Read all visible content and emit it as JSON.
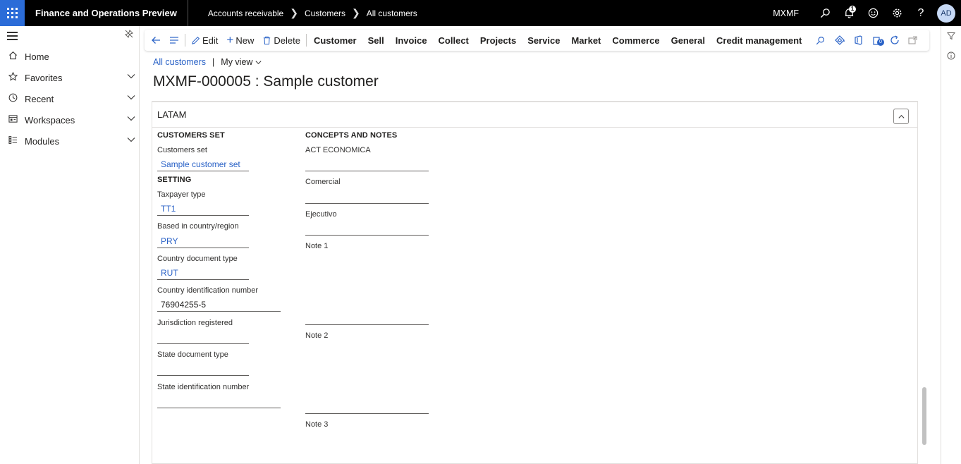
{
  "topbar": {
    "app_title": "Finance and Operations Preview",
    "breadcrumbs": [
      "Accounts receivable",
      "Customers",
      "All customers"
    ],
    "company": "MXMF",
    "notification_count": "1",
    "user_initials": "AD",
    "icons": [
      "waffle-icon",
      "search-icon",
      "bell-icon",
      "smiley-icon",
      "gear-icon",
      "help-icon"
    ]
  },
  "nav": {
    "items": [
      {
        "label": "Home",
        "icon": "home-icon",
        "expandable": false
      },
      {
        "label": "Favorites",
        "icon": "star-icon",
        "expandable": true
      },
      {
        "label": "Recent",
        "icon": "clock-icon",
        "expandable": true
      },
      {
        "label": "Workspaces",
        "icon": "workspaces-icon",
        "expandable": true
      },
      {
        "label": "Modules",
        "icon": "modules-icon",
        "expandable": true
      }
    ]
  },
  "actionpane": {
    "edit": "Edit",
    "new": "New",
    "delete": "Delete",
    "tabs": [
      "Customer",
      "Sell",
      "Invoice",
      "Collect",
      "Projects",
      "Service",
      "Market",
      "Commerce",
      "General",
      "Credit management"
    ],
    "more": "···",
    "attachments_count": "0"
  },
  "page": {
    "breadcrumb_link": "All customers",
    "breadcrumb_sep": "|",
    "view": "My view",
    "title": "MXMF-000005 : Sample customer"
  },
  "fasttab": {
    "title": "LATAM"
  },
  "form": {
    "customers_set_group": "CUSTOMERS SET",
    "customers_set_label": "Customers set",
    "customers_set_value": "Sample customer set",
    "setting_group": "SETTING",
    "taxpayer_type_label": "Taxpayer type",
    "taxpayer_type_value": "TT1",
    "based_in_label": "Based in country/region",
    "based_in_value": "PRY",
    "country_doc_type_label": "Country document type",
    "country_doc_type_value": "RUT",
    "country_id_label": "Country identification number",
    "country_id_value": "76904255-5",
    "jurisdiction_label": "Jurisdiction registered",
    "state_doc_type_label": "State document type",
    "state_id_label": "State identification number",
    "concepts_group": "CONCEPTS AND NOTES",
    "act_economica_label": "ACT ECONOMICA",
    "comercial_label": "Comercial",
    "ejecutivo_label": "Ejecutivo",
    "note1_label": "Note 1",
    "note2_label": "Note 2",
    "note3_label": "Note 3"
  }
}
